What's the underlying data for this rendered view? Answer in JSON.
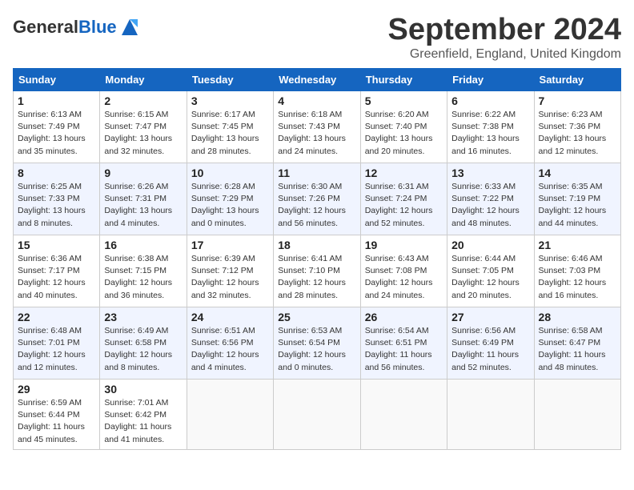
{
  "header": {
    "logo_general": "General",
    "logo_blue": "Blue",
    "month": "September 2024",
    "location": "Greenfield, England, United Kingdom"
  },
  "days_of_week": [
    "Sunday",
    "Monday",
    "Tuesday",
    "Wednesday",
    "Thursday",
    "Friday",
    "Saturday"
  ],
  "weeks": [
    [
      {
        "day": "1",
        "info": "Sunrise: 6:13 AM\nSunset: 7:49 PM\nDaylight: 13 hours\nand 35 minutes."
      },
      {
        "day": "2",
        "info": "Sunrise: 6:15 AM\nSunset: 7:47 PM\nDaylight: 13 hours\nand 32 minutes."
      },
      {
        "day": "3",
        "info": "Sunrise: 6:17 AM\nSunset: 7:45 PM\nDaylight: 13 hours\nand 28 minutes."
      },
      {
        "day": "4",
        "info": "Sunrise: 6:18 AM\nSunset: 7:43 PM\nDaylight: 13 hours\nand 24 minutes."
      },
      {
        "day": "5",
        "info": "Sunrise: 6:20 AM\nSunset: 7:40 PM\nDaylight: 13 hours\nand 20 minutes."
      },
      {
        "day": "6",
        "info": "Sunrise: 6:22 AM\nSunset: 7:38 PM\nDaylight: 13 hours\nand 16 minutes."
      },
      {
        "day": "7",
        "info": "Sunrise: 6:23 AM\nSunset: 7:36 PM\nDaylight: 13 hours\nand 12 minutes."
      }
    ],
    [
      {
        "day": "8",
        "info": "Sunrise: 6:25 AM\nSunset: 7:33 PM\nDaylight: 13 hours\nand 8 minutes."
      },
      {
        "day": "9",
        "info": "Sunrise: 6:26 AM\nSunset: 7:31 PM\nDaylight: 13 hours\nand 4 minutes."
      },
      {
        "day": "10",
        "info": "Sunrise: 6:28 AM\nSunset: 7:29 PM\nDaylight: 13 hours\nand 0 minutes."
      },
      {
        "day": "11",
        "info": "Sunrise: 6:30 AM\nSunset: 7:26 PM\nDaylight: 12 hours\nand 56 minutes."
      },
      {
        "day": "12",
        "info": "Sunrise: 6:31 AM\nSunset: 7:24 PM\nDaylight: 12 hours\nand 52 minutes."
      },
      {
        "day": "13",
        "info": "Sunrise: 6:33 AM\nSunset: 7:22 PM\nDaylight: 12 hours\nand 48 minutes."
      },
      {
        "day": "14",
        "info": "Sunrise: 6:35 AM\nSunset: 7:19 PM\nDaylight: 12 hours\nand 44 minutes."
      }
    ],
    [
      {
        "day": "15",
        "info": "Sunrise: 6:36 AM\nSunset: 7:17 PM\nDaylight: 12 hours\nand 40 minutes."
      },
      {
        "day": "16",
        "info": "Sunrise: 6:38 AM\nSunset: 7:15 PM\nDaylight: 12 hours\nand 36 minutes."
      },
      {
        "day": "17",
        "info": "Sunrise: 6:39 AM\nSunset: 7:12 PM\nDaylight: 12 hours\nand 32 minutes."
      },
      {
        "day": "18",
        "info": "Sunrise: 6:41 AM\nSunset: 7:10 PM\nDaylight: 12 hours\nand 28 minutes."
      },
      {
        "day": "19",
        "info": "Sunrise: 6:43 AM\nSunset: 7:08 PM\nDaylight: 12 hours\nand 24 minutes."
      },
      {
        "day": "20",
        "info": "Sunrise: 6:44 AM\nSunset: 7:05 PM\nDaylight: 12 hours\nand 20 minutes."
      },
      {
        "day": "21",
        "info": "Sunrise: 6:46 AM\nSunset: 7:03 PM\nDaylight: 12 hours\nand 16 minutes."
      }
    ],
    [
      {
        "day": "22",
        "info": "Sunrise: 6:48 AM\nSunset: 7:01 PM\nDaylight: 12 hours\nand 12 minutes."
      },
      {
        "day": "23",
        "info": "Sunrise: 6:49 AM\nSunset: 6:58 PM\nDaylight: 12 hours\nand 8 minutes."
      },
      {
        "day": "24",
        "info": "Sunrise: 6:51 AM\nSunset: 6:56 PM\nDaylight: 12 hours\nand 4 minutes."
      },
      {
        "day": "25",
        "info": "Sunrise: 6:53 AM\nSunset: 6:54 PM\nDaylight: 12 hours\nand 0 minutes."
      },
      {
        "day": "26",
        "info": "Sunrise: 6:54 AM\nSunset: 6:51 PM\nDaylight: 11 hours\nand 56 minutes."
      },
      {
        "day": "27",
        "info": "Sunrise: 6:56 AM\nSunset: 6:49 PM\nDaylight: 11 hours\nand 52 minutes."
      },
      {
        "day": "28",
        "info": "Sunrise: 6:58 AM\nSunset: 6:47 PM\nDaylight: 11 hours\nand 48 minutes."
      }
    ],
    [
      {
        "day": "29",
        "info": "Sunrise: 6:59 AM\nSunset: 6:44 PM\nDaylight: 11 hours\nand 45 minutes."
      },
      {
        "day": "30",
        "info": "Sunrise: 7:01 AM\nSunset: 6:42 PM\nDaylight: 11 hours\nand 41 minutes."
      },
      {
        "day": "",
        "info": ""
      },
      {
        "day": "",
        "info": ""
      },
      {
        "day": "",
        "info": ""
      },
      {
        "day": "",
        "info": ""
      },
      {
        "day": "",
        "info": ""
      }
    ]
  ]
}
